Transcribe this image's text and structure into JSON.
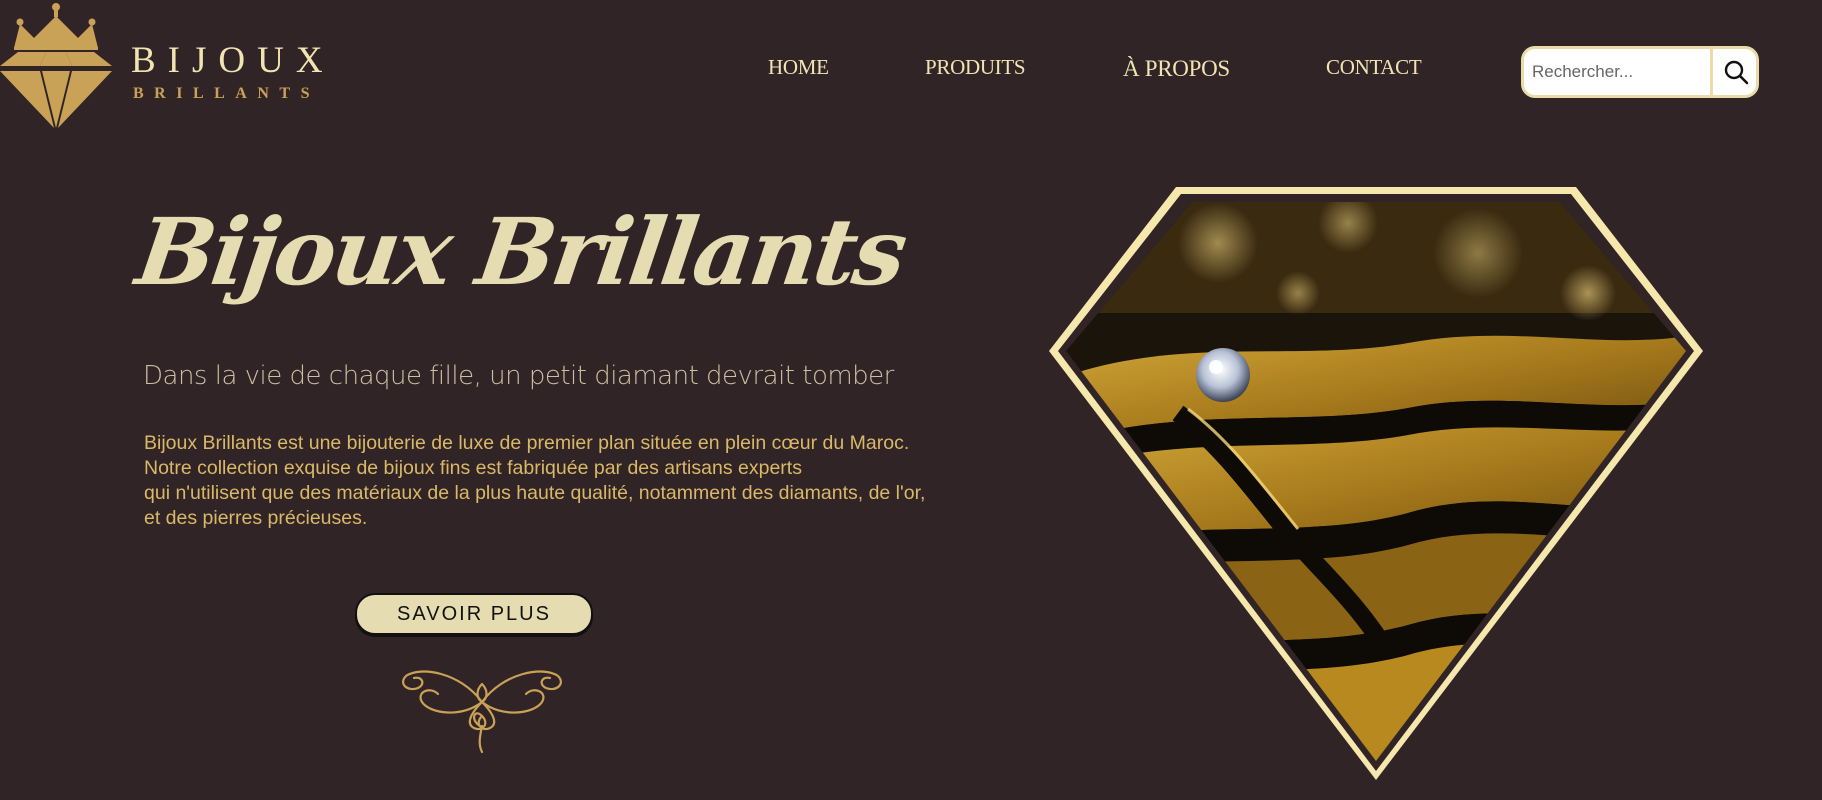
{
  "brand": {
    "name": "BIJOUX",
    "subtitle": "BRILLANTS"
  },
  "nav": {
    "items": [
      {
        "label": "HOME"
      },
      {
        "label": "PRODUITS"
      },
      {
        "label": "À PROPOS"
      },
      {
        "label": "CONTACT"
      }
    ]
  },
  "search": {
    "placeholder": "Rechercher...",
    "value": ""
  },
  "hero": {
    "title": "Bijoux Brillants",
    "tagline": "Dans la vie de chaque fille, un petit diamant devrait tomber",
    "description_lines": [
      "Bijoux Brillants est une bijouterie de luxe de premier plan située en plein cœur du Maroc.",
      "Notre collection exquise de bijoux fins est fabriquée par des artisans experts",
      "qui n'utilisent que des matériaux de la plus haute qualité, notamment des diamants, de l'or,",
      "et des pierres précieuses."
    ],
    "cta_label": "SAVOIR PLUS"
  },
  "colors": {
    "background": "#312426",
    "cream": "#e6dcb2",
    "gold": "#c9a157",
    "text_gold": "#d9b868"
  },
  "icons": [
    "crown-icon",
    "diamond-logo-icon",
    "search-icon",
    "ornament-flourish-icon"
  ]
}
